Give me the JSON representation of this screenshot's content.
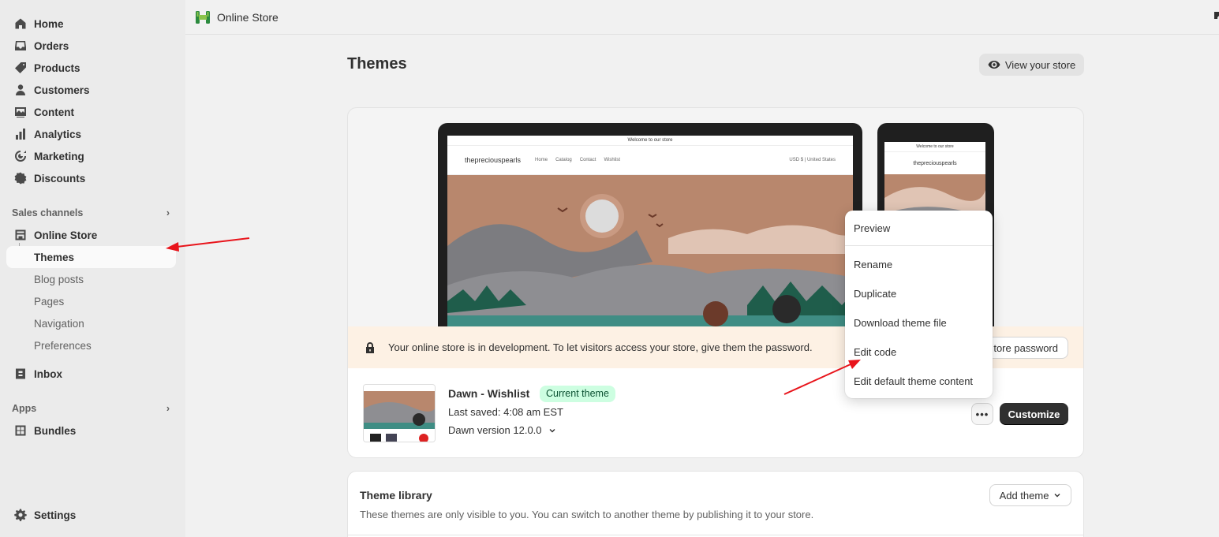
{
  "sidebar": {
    "items": [
      {
        "label": "Home",
        "icon": "home-icon"
      },
      {
        "label": "Orders",
        "icon": "inbox-tray-icon"
      },
      {
        "label": "Products",
        "icon": "tag-icon"
      },
      {
        "label": "Customers",
        "icon": "person-icon"
      },
      {
        "label": "Content",
        "icon": "image-icon"
      },
      {
        "label": "Analytics",
        "icon": "bar-chart-icon"
      },
      {
        "label": "Marketing",
        "icon": "target-icon"
      },
      {
        "label": "Discounts",
        "icon": "discount-icon"
      }
    ],
    "sales_channels_label": "Sales channels",
    "online_store_label": "Online Store",
    "sub_items": [
      "Themes",
      "Blog posts",
      "Pages",
      "Navigation",
      "Preferences"
    ],
    "inbox_label": "Inbox",
    "apps_label": "Apps",
    "bundles_label": "Bundles",
    "settings_label": "Settings"
  },
  "topbar": {
    "title": "Online Store"
  },
  "main": {
    "page_title": "Themes",
    "view_store_label": "View your store",
    "preview": {
      "announcement": "Welcome to our store",
      "store_name": "thepreciouspearls",
      "nav_links": [
        "Home",
        "Catalog",
        "Contact",
        "Wishlist"
      ],
      "currency": "USD $ | United States"
    },
    "dev_banner_text": "Your online store is in development. To let visitors access your store, give them the password.",
    "store_password_label": "tore password",
    "current_theme": {
      "name": "Dawn - Wishlist",
      "badge": "Current theme",
      "last_saved": "Last saved: 4:08 am EST",
      "version": "Dawn version 12.0.0",
      "more_label": "•••",
      "customize_label": "Customize"
    },
    "library": {
      "title": "Theme library",
      "subtitle": "These themes are only visible to you. You can switch to another theme by publishing it to your store.",
      "add_theme_label": "Add theme"
    }
  },
  "menu": {
    "items": [
      "Preview",
      "Rename",
      "Duplicate",
      "Download theme file",
      "Edit code",
      "Edit default theme content"
    ]
  },
  "colors": {
    "annotation_arrow": "#e8141b",
    "badge_bg": "#cdfee1",
    "customize_bg": "#303030"
  }
}
